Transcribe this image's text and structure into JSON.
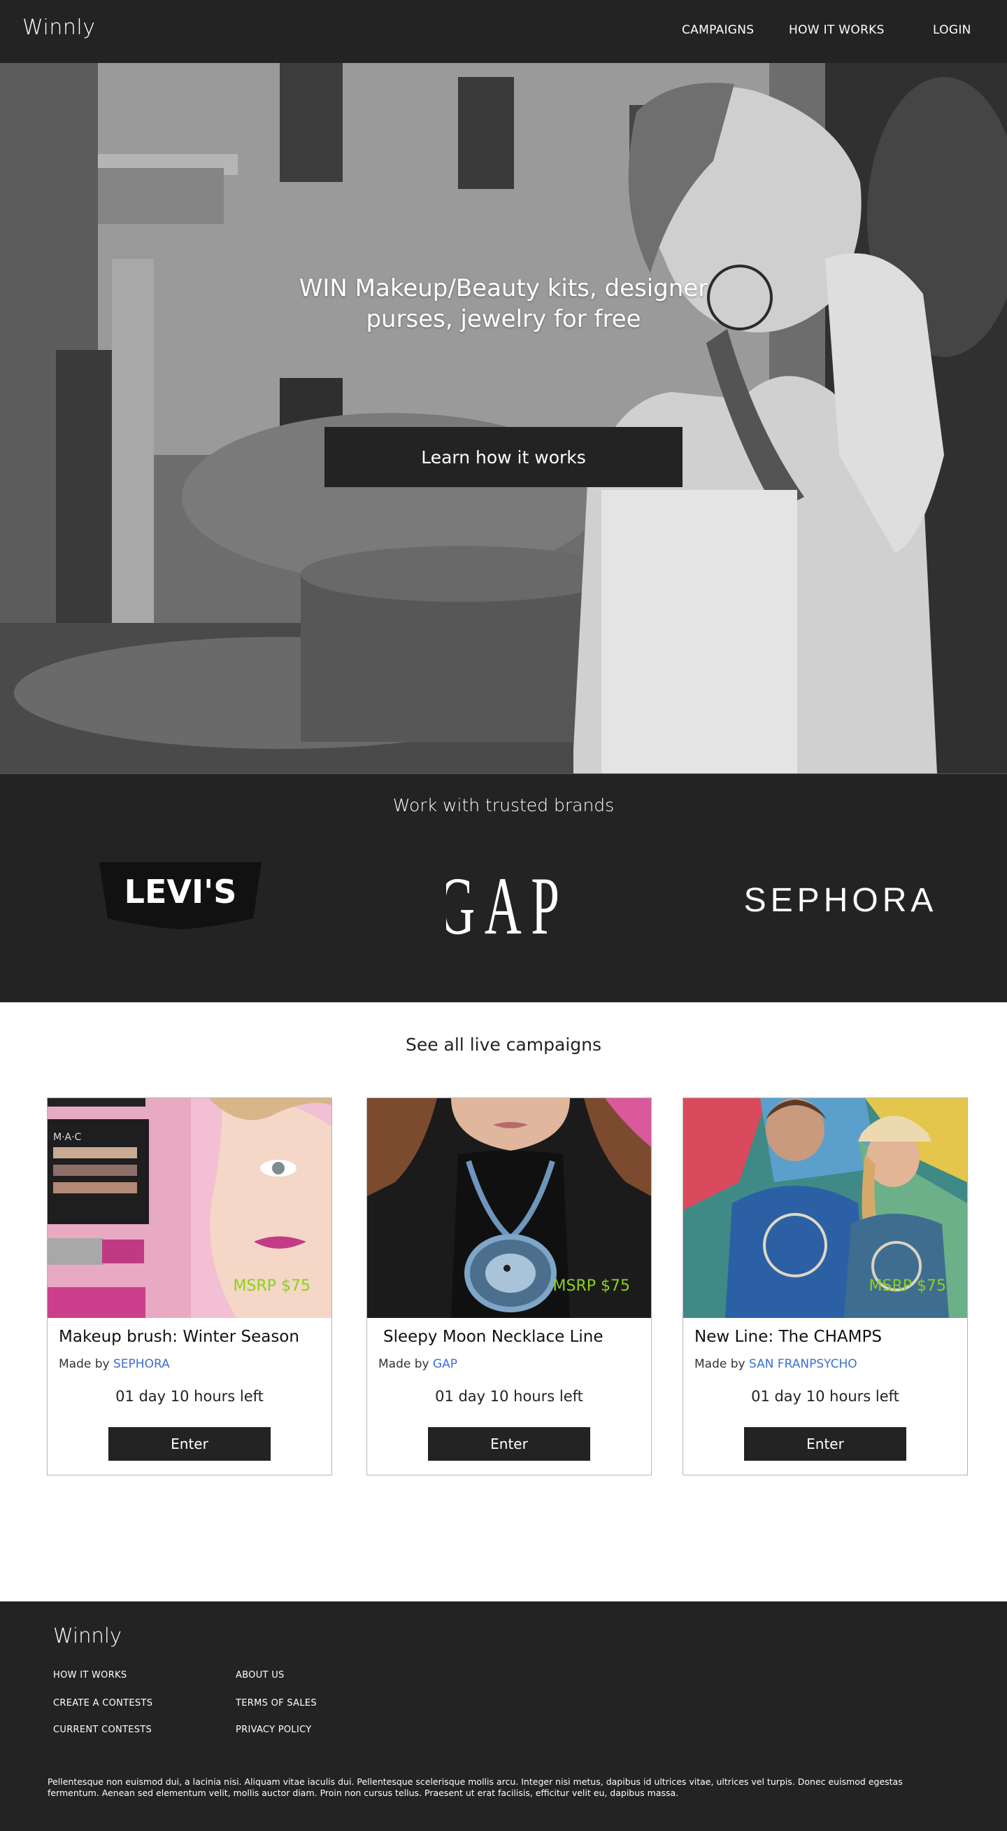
{
  "header": {
    "logo": "Winnly",
    "nav": [
      "CAMPAIGNS",
      "HOW IT WORKS",
      "LOGIN"
    ]
  },
  "hero": {
    "title_line1": "WIN Makeup/Beauty kits, designer",
    "title_line2": "purses, jewelry for free",
    "button_label": "Learn how it works"
  },
  "brands": {
    "title": "Work with trusted brands",
    "items": [
      "LEVI'S",
      "GAP",
      "SEPHORA"
    ]
  },
  "campaigns": {
    "title": "See all live campaigns",
    "cards": [
      {
        "title": "Makeup brush: Winter Season",
        "made_by_prefix": "Made by",
        "maker": "SEPHORA",
        "msrp": "MSRP $75",
        "time_left": "01 day 10 hours left",
        "button": "Enter"
      },
      {
        "title": "Sleepy Moon Necklace Line",
        "made_by_prefix": "Made by",
        "maker": "GAP",
        "msrp": "MSRP $75",
        "time_left": "01 day 10 hours left",
        "button": "Enter"
      },
      {
        "title": "New Line: The CHAMPS",
        "made_by_prefix": "Made by",
        "maker": "SAN FRANPSYCHO",
        "msrp": "MSRP $75",
        "time_left": "01 day 10 hours left",
        "button": "Enter"
      }
    ]
  },
  "footer": {
    "logo": "Winnly",
    "col1": [
      "HOW IT WORKS",
      "CREATE A  CONTESTS",
      "CURRENT CONTESTS"
    ],
    "col2": [
      "ABOUT US",
      "TERMS OF SALES",
      "PRIVACY POLICY"
    ],
    "text": "Pellentesque non euismod dui, a lacinia nisi. Aliquam vitae iaculis dui. Pellentesque scelerisque mollis arcu. Integer nisi metus, dapibus id ultrices vitae, ultrices vel turpis. Donec euismod egestas fermentum. Aenean sed elementum velit, mollis auctor diam. Proin non cursus tellus. Praesent ut erat facilisis, efficitur velit eu, dapibus massa."
  },
  "colors": {
    "dark": "#232323",
    "msrp_green": "#8cd11d",
    "link_blue": "#3c6fd6"
  }
}
